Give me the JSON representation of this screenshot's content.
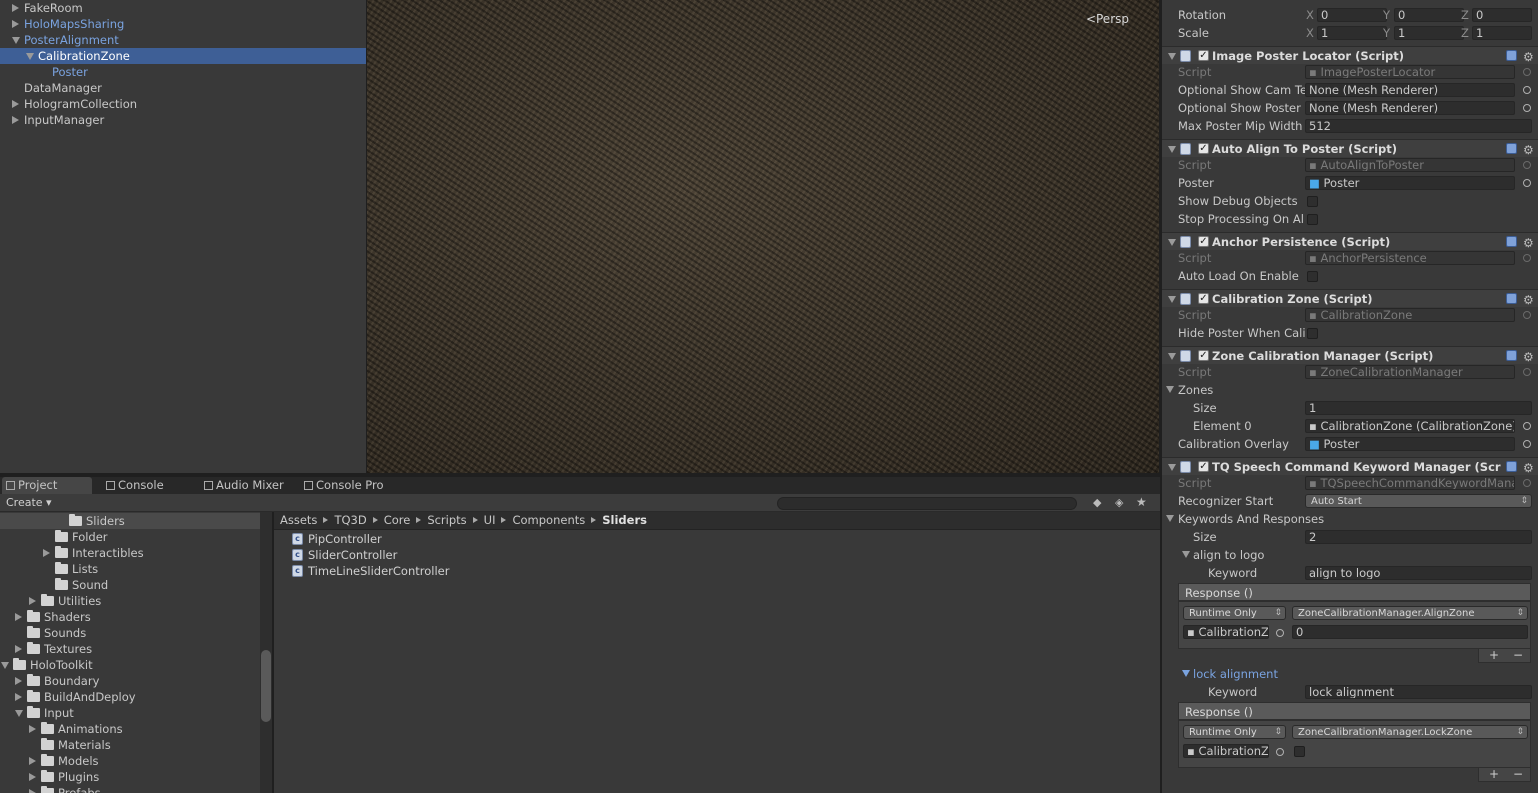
{
  "hierarchy": {
    "items": [
      {
        "label": "FakeRoom",
        "indent": 0,
        "expand": "r",
        "color": "normal"
      },
      {
        "label": "HoloMapsSharing",
        "indent": 0,
        "expand": "r",
        "color": "blue"
      },
      {
        "label": "PosterAlignment",
        "indent": 0,
        "expand": "d",
        "color": "blue"
      },
      {
        "label": "CalibrationZone",
        "indent": 1,
        "expand": "d",
        "color": "selected"
      },
      {
        "label": "Poster",
        "indent": 2,
        "expand": "",
        "color": "blue"
      },
      {
        "label": "DataManager",
        "indent": 0,
        "expand": "",
        "color": "normal"
      },
      {
        "label": "HologramCollection",
        "indent": 0,
        "expand": "r",
        "color": "normal"
      },
      {
        "label": "InputManager",
        "indent": 0,
        "expand": "r",
        "color": "normal"
      }
    ]
  },
  "scene": {
    "persp_label": "Persp"
  },
  "tabs": [
    {
      "label": "Project",
      "active": true
    },
    {
      "label": "Console",
      "active": false
    },
    {
      "label": "Audio Mixer",
      "active": false
    },
    {
      "label": "Console Pro",
      "active": false
    }
  ],
  "project": {
    "create_label": "Create",
    "tree": [
      {
        "label": "Sliders",
        "indent": 6,
        "expand": "",
        "sel": true
      },
      {
        "label": "Folder",
        "indent": 5,
        "expand": ""
      },
      {
        "label": "Interactibles",
        "indent": 5,
        "expand": "r"
      },
      {
        "label": "Lists",
        "indent": 5,
        "expand": ""
      },
      {
        "label": "Sound",
        "indent": 5,
        "expand": ""
      },
      {
        "label": "Utilities",
        "indent": 4,
        "expand": "r"
      },
      {
        "label": "Shaders",
        "indent": 3,
        "expand": "r"
      },
      {
        "label": "Sounds",
        "indent": 3,
        "expand": ""
      },
      {
        "label": "Textures",
        "indent": 3,
        "expand": "r"
      },
      {
        "label": "HoloToolkit",
        "indent": 2,
        "expand": "d"
      },
      {
        "label": "Boundary",
        "indent": 3,
        "expand": "r"
      },
      {
        "label": "BuildAndDeploy",
        "indent": 3,
        "expand": "r"
      },
      {
        "label": "Input",
        "indent": 3,
        "expand": "d"
      },
      {
        "label": "Animations",
        "indent": 4,
        "expand": "r"
      },
      {
        "label": "Materials",
        "indent": 4,
        "expand": ""
      },
      {
        "label": "Models",
        "indent": 4,
        "expand": "r"
      },
      {
        "label": "Plugins",
        "indent": 4,
        "expand": "r"
      },
      {
        "label": "Prefabs",
        "indent": 4,
        "expand": "r"
      }
    ],
    "breadcrumb": [
      "Assets",
      "TQ3D",
      "Core",
      "Scripts",
      "UI",
      "Components",
      "Sliders"
    ],
    "files": [
      "PipController",
      "SliderController",
      "TimeLineSliderController"
    ]
  },
  "inspector": {
    "rotation_label": "Rotation",
    "scale_label": "Scale",
    "rotation": {
      "x": "0",
      "y": "0",
      "z": "0"
    },
    "scale": {
      "x": "1",
      "y": "1",
      "z": "1"
    },
    "axes": {
      "x": "X",
      "y": "Y",
      "z": "Z"
    },
    "script_label": "Script",
    "c1": {
      "title": "Image Poster Locator (Script)",
      "script": "ImagePosterLocator",
      "f1_label": "Optional Show Cam Te",
      "f1_value": "None (Mesh Renderer)",
      "f2_label": "Optional Show Poster",
      "f2_value": "None (Mesh Renderer)",
      "f3_label": "Max Poster Mip Width",
      "f3_value": "512"
    },
    "c2": {
      "title": "Auto Align To Poster (Script)",
      "script": "AutoAlignToPoster",
      "poster_label": "Poster",
      "poster_value": "Poster",
      "debug_label": "Show Debug Objects",
      "stop_label": "Stop Processing On Al"
    },
    "c3": {
      "title": "Anchor Persistence (Script)",
      "script": "AnchorPersistence",
      "auto_label": "Auto Load On Enable"
    },
    "c4": {
      "title": "Calibration Zone (Script)",
      "script": "CalibrationZone",
      "hide_label": "Hide Poster When Cali"
    },
    "c5": {
      "title": "Zone Calibration Manager (Script)",
      "script": "ZoneCalibrationManager",
      "zones_label": "Zones",
      "size_label": "Size",
      "size_value": "1",
      "el_label": "Element 0",
      "el_value": "CalibrationZone (CalibrationZone)",
      "overlay_label": "Calibration Overlay",
      "overlay_value": "Poster"
    },
    "c6": {
      "title": "TQ Speech Command Keyword Manager (Scr",
      "script": "TQSpeechCommandKeywordMana",
      "rec_label": "Recognizer Start",
      "rec_value": "Auto Start",
      "kr_label": "Keywords And Responses",
      "size_label": "Size",
      "size_value": "2",
      "keyword_label": "Keyword",
      "response_label": "Response ()",
      "runtime": "Runtime Only",
      "k1": {
        "name": "align to logo",
        "keyword": "align to logo",
        "method": "ZoneCalibrationManager.AlignZone",
        "obj": "CalibrationZ",
        "arg": "0"
      },
      "k2": {
        "name": "lock alignment",
        "keyword": "lock alignment",
        "method": "ZoneCalibrationManager.LockZone",
        "obj": "CalibrationZ"
      }
    },
    "plus": "+",
    "minus": "−"
  },
  "colors": {
    "selection": "#3e5f96",
    "prefab_blue": "#7aa3e0"
  }
}
